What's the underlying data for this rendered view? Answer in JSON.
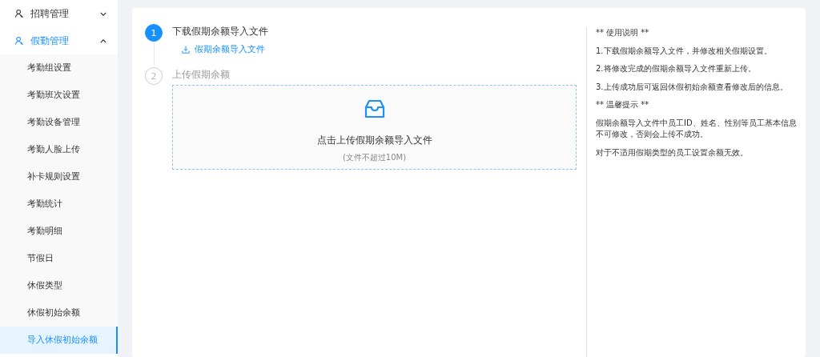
{
  "sidebar": {
    "groups": [
      {
        "label": "招聘管理",
        "expanded": false
      },
      {
        "label": "假勤管理",
        "expanded": true,
        "children": [
          {
            "label": "考勤组设置",
            "selected": false
          },
          {
            "label": "考勤班次设置",
            "selected": false
          },
          {
            "label": "考勤设备管理",
            "selected": false
          },
          {
            "label": "考勤人脸上传",
            "selected": false
          },
          {
            "label": "补卡规则设置",
            "selected": false
          },
          {
            "label": "考勤统计",
            "selected": false
          },
          {
            "label": "考勤明细",
            "selected": false
          },
          {
            "label": "节假日",
            "selected": false
          },
          {
            "label": "休假类型",
            "selected": false
          },
          {
            "label": "休假初始余额",
            "selected": false
          },
          {
            "label": "导入休假初始余额",
            "selected": true
          }
        ]
      }
    ]
  },
  "steps": [
    {
      "number": "1",
      "title": "下载假期余额导入文件",
      "active": true,
      "link": "假期余额导入文件"
    },
    {
      "number": "2",
      "title": "上传假期余额",
      "active": false,
      "upload": {
        "label": "点击上传假期余额导入文件",
        "hint": "(文件不超过10M)"
      }
    }
  ],
  "instructions": [
    "** 使用说明 **",
    "1.下载假期余额导入文件，并修改相关假期设置。",
    "2.将修改完成的假期余额导入文件重新上传。",
    "3.上传成功后可返回休假初始余额查看修改后的信息。",
    "** 温馨提示 **",
    "假期余额导入文件中员工ID、姓名、性别等员工基本信息不可修改，否则会上传不成功。",
    "对于不适用假期类型的员工设置余额无效。"
  ]
}
